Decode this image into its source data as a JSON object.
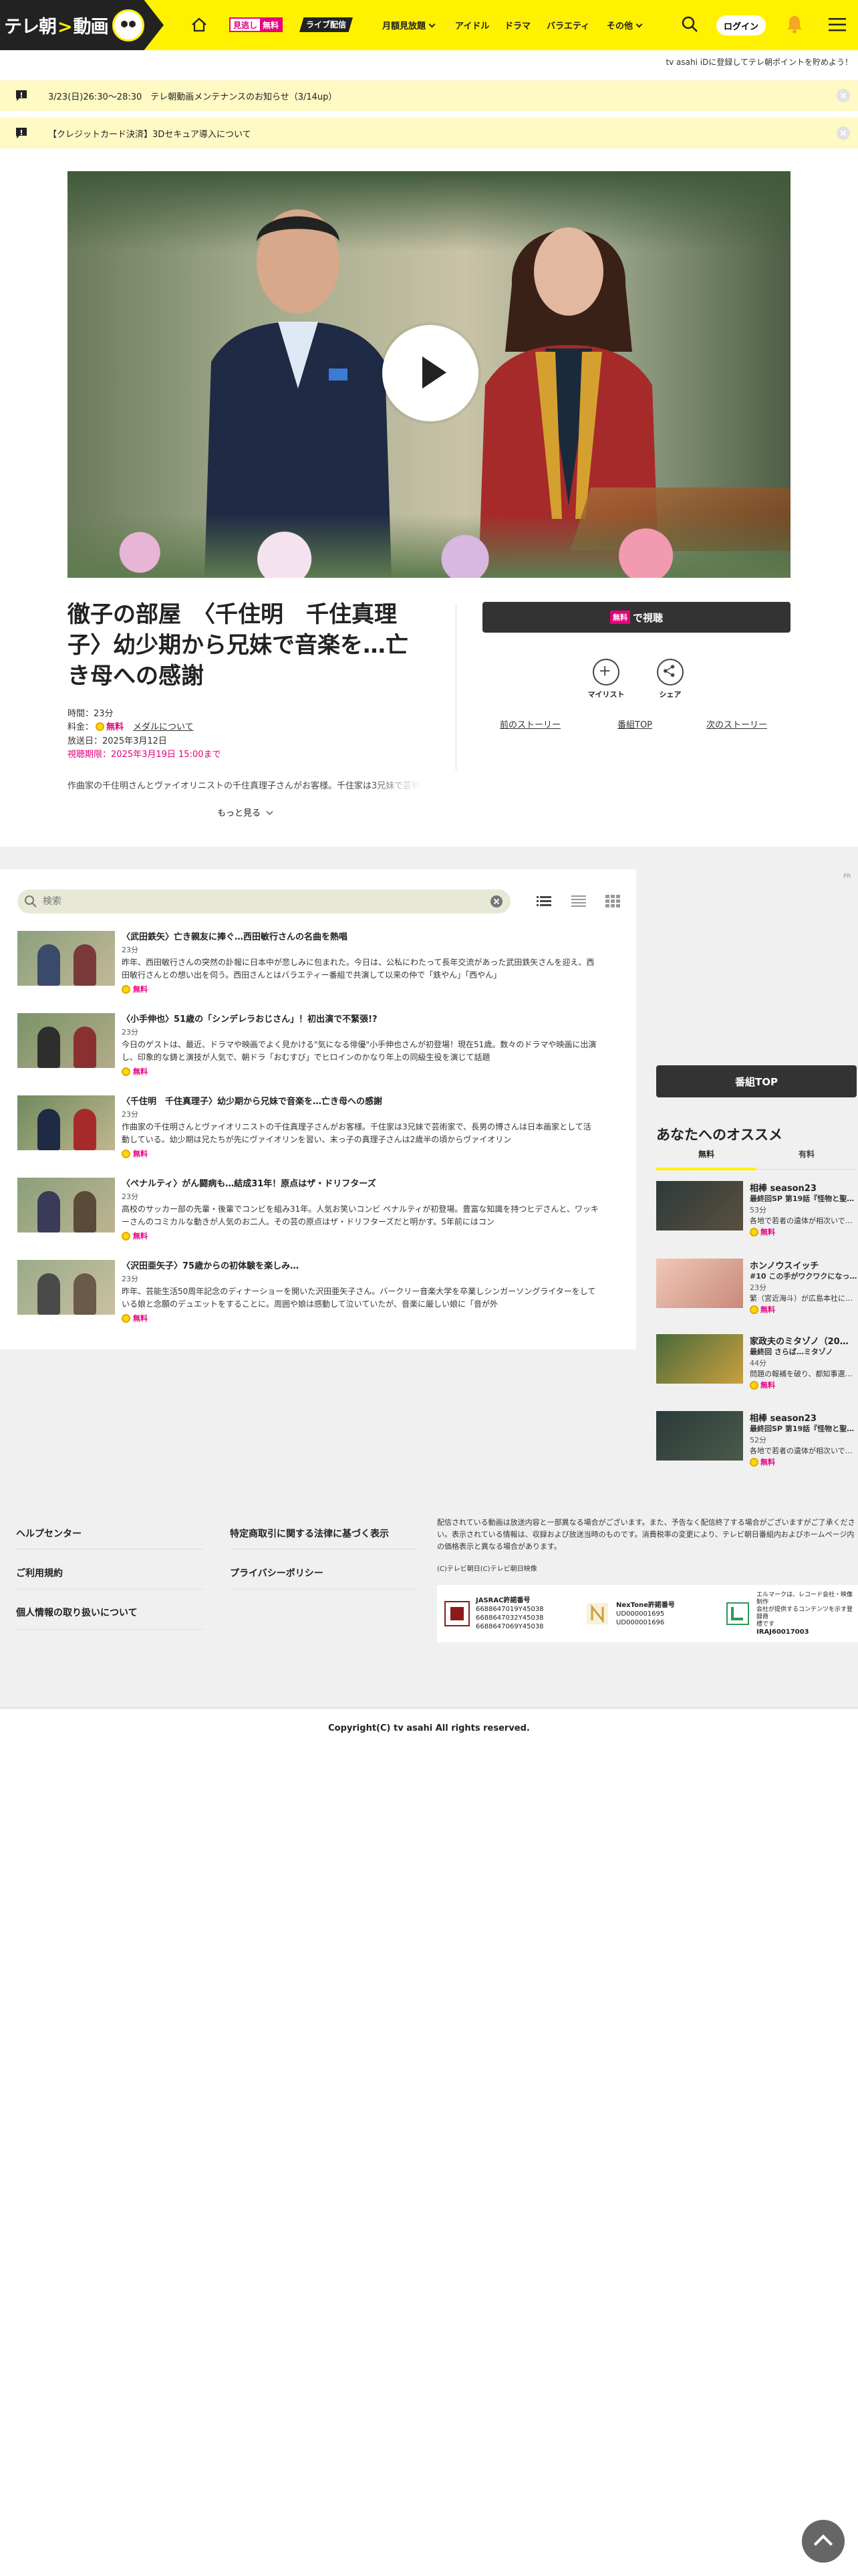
{
  "header": {
    "logo_text": "テレ朝",
    "logo_text2": "動画",
    "free_tag_a": "見逃し",
    "free_tag_b": "無料",
    "live_tag": "ライブ配信",
    "nav": [
      {
        "label": "月額見放題",
        "dropdown": true
      },
      {
        "label": "アイドル",
        "dropdown": false
      },
      {
        "label": "ドラマ",
        "dropdown": false
      },
      {
        "label": "バラエティ",
        "dropdown": false
      },
      {
        "label": "その他",
        "dropdown": true
      }
    ],
    "login_label": "ログイン",
    "icons": [
      "home-icon",
      "search-icon",
      "bell-icon",
      "menu-icon"
    ],
    "colors": {
      "brand_yellow": "#fff100",
      "accent_pink": "#e6007e"
    }
  },
  "promo_text": "tv asahi iDに登録してテレ朝ポイントを貯めよう！",
  "notices": [
    "3/23(日)26:30〜28:30　テレ朝動画メンテナンスのお知らせ（3/14up）",
    "【クレジットカード決済】3Dセキュア導入について"
  ],
  "episode": {
    "title": "徹子の部屋　〈千住明　千住真理子〉幼少期から兄妹で音楽を…亡き母への感謝",
    "duration": "時間：23分",
    "price_label": "料金：",
    "price_free": "無料",
    "medal_link": "メダルについて",
    "air_date": "放送日：2025年3月12日",
    "deadline": "視聴期限：2025年3月19日 15:00まで",
    "description": "作曲家の千住明さんとヴァイオリニストの千住真理子さんがお客様。千住家は3兄妹で芸術",
    "more_label": "もっと見る",
    "watch_badge": "無料",
    "watch_label": "で視聴",
    "mylist_label": "マイリスト",
    "share_label": "シェア",
    "prev_story": "前のストーリー",
    "program_top": "番組TOP",
    "next_story": "次のストーリー"
  },
  "list": {
    "pr": "PR",
    "search_placeholder": "検索",
    "items": [
      {
        "title": "〈武田鉄矢〉亡き親友に捧ぐ…西田敏行さんの名曲を熱唱",
        "duration": "23分",
        "desc": "昨年、西田敏行さんの突然の訃報に日本中が悲しみに包まれた。今日は、公私にわたって長年交流があった武田鉄矢さんを迎え、西田敏行さんとの想い出を伺う。西田さんとはバラエティー番組で共演して以来の仲で「鉄やん」「西やん」",
        "free": "無料"
      },
      {
        "title": "〈小手伸也〉51歳の「シンデレラおじさん」！初出演で不緊張!?",
        "duration": "23分",
        "desc": "今日のゲストは、最近、ドラマや映画でよく見かける\"気になる俳優\"小手伸也さんが初登場！現在51歳。数々のドラマや映画に出演し、印象的な鋳と演技が人気で、朝ドラ「おむすび」でヒロインのかなり年上の同級生役を演じて話題",
        "free": "無料"
      },
      {
        "title": "〈千住明　千住真理子〉幼少期から兄妹で音楽を…亡き母への感謝",
        "duration": "23分",
        "desc": "作曲家の千住明さんとヴァイオリニストの千住真理子さんがお客様。千住家は3兄妹で芸術家で、長男の博さんは日本画家として活動している。幼少期は兄たちが先にヴァイオリンを習い、末っ子の真理子さんは2歳半の頃からヴァイオリン",
        "free": "無料"
      },
      {
        "title": "〈ペナルティ〉がん闘病も…結成31年！原点はザ・ドリフターズ",
        "duration": "23分",
        "desc": "高校のサッカー部の先輩・後輩でコンビを組み31年。人気お笑いコンビ ペナルティが初登場。豊富な知識を持つヒデさんと、ワッキーさんのコミカルな動きが人気のお二人。その芸の原点はザ・ドリフターズだと明かす。5年前にはコン",
        "free": "無料"
      },
      {
        "title": "〈沢田亜矢子〉75歳からの初体験を楽しみ…",
        "duration": "23分",
        "desc": "昨年、芸能生活50周年記念のディナーショーを開いた沢田亜矢子さん。バークリー音楽大学を卒業しシンガーソングライターをしている娘と念願のデュエットをすることに。周囲や娘は感動して泣いていたが、音楽に厳しい娘に「音が外",
        "free": "無料"
      }
    ]
  },
  "sidebar": {
    "program_top": "番組TOP",
    "rec_heading": "あなたへのオススメ",
    "tabs": [
      "無料",
      "有料"
    ],
    "items": [
      {
        "title": "相棒 season23",
        "sub": "最終回SP 第19話『怪物と聖…",
        "duration": "53分",
        "desc": "各地で若者の遺体が相次いで…",
        "free": "無料"
      },
      {
        "title": "ホンノウスイッチ",
        "sub": "#10 この手がワクワクになっ…",
        "duration": "23分",
        "desc": "繁（宮近海斗）が広島本社に…",
        "free": "無料"
      },
      {
        "title": "家政夫のミタゾノ（20…",
        "sub": "最終回 さらば…ミタゾノ",
        "duration": "44分",
        "desc": "問題の報補を破り、都知事選…",
        "free": "無料"
      },
      {
        "title": "相棒 season23",
        "sub": "最終回SP 第19話『怪物と聖…",
        "duration": "52分",
        "desc": "各地で若者の遺体が相次いで…",
        "free": "無料"
      }
    ]
  },
  "footer": {
    "links": [
      "ヘルプセンター",
      "特定商取引に関する法律に基づく表示",
      "ご利用規約",
      "プライバシーポリシー",
      "個人情報の取り扱いについて"
    ],
    "note": "配信されている動画は放送内容と一部異なる場合がございます。また、予告なく配信終了する場合がございますがご了承ください。表示されている情報は、収録および放送当時のものです。消費税率の変更により、テレビ朝日番組内およびホームページ内の価格表示と異なる場合があります。",
    "small_copy": "(C)テレビ朝日(C)テレビ朝日映像",
    "licenses": [
      {
        "name": "JASRAC許諾番号",
        "lines": [
          "6688647019Y45038",
          "6688647032Y45038",
          "6688647069Y45038"
        ]
      },
      {
        "name": "NexTone許諾番号",
        "lines": [
          "UD000001695",
          "UD000001696"
        ]
      },
      {
        "name": "エルマーク",
        "lines": [
          "エルマークは、レコード会社・映像制作",
          "会社が提供するコンテンツを示す登録商",
          "標です",
          "IRAJ60017003"
        ]
      }
    ],
    "copyright": "Copyright(C) tv asahi All rights reserved."
  }
}
